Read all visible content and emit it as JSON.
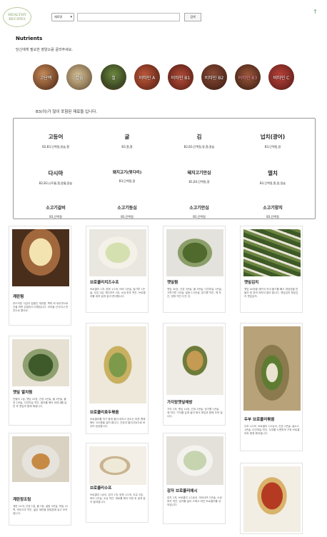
{
  "header": {
    "logo_text": "HEALTHY RECIPES",
    "select_value": "재료명",
    "search_placeholder": "",
    "search_button": "검색",
    "top_icon": "arrow-up-icon"
  },
  "page": {
    "title": "Nutrients",
    "subtitle": "당신에게 필요한 영양소를 골라주세요."
  },
  "nutrients": [
    {
      "label": "고단백"
    },
    {
      "label": "칼슘"
    },
    {
      "label": "철"
    },
    {
      "label": "비타민 A"
    },
    {
      "label": "비타민 B1"
    },
    {
      "label": "비타민 B2"
    },
    {
      "label": "비타민 B3"
    },
    {
      "label": "비타민 C"
    }
  ],
  "active_nutrient_index": 6,
  "hint": "B3(이)가 많이 포함된 재료들 입니다.",
  "foods": [
    {
      "name": "고등어",
      "sub": "B2,B3,단백질,칼슘,철"
    },
    {
      "name": "굴",
      "sub": "B3,철,철"
    },
    {
      "name": "김",
      "sub": "B2,B3,단백질,칼,철,칼슘"
    },
    {
      "name": "넙치(광어)",
      "sub": "B3,단백질,칼"
    },
    {
      "name": "다시마",
      "sub": "B2,B3,니트륨,철,칼륨,칼슘"
    },
    {
      "name": "돼지고기(뒷다리)",
      "sub": "B3,단백질,칼"
    },
    {
      "name": "돼지고기안심",
      "sub": "B1,B3,단백질,칼"
    },
    {
      "name": "멸치",
      "sub": "B3,단백질,철,칼,칼슘"
    },
    {
      "name": "소고기갈비",
      "sub": "B3,단백질"
    },
    {
      "name": "소고기등심",
      "sub": "B3,단백질"
    },
    {
      "name": "소고기안심",
      "sub": "B3,단백질"
    },
    {
      "name": "소고기양지",
      "sub": "B3,단백질"
    }
  ],
  "recipes": [
    {
      "title": "계란찜",
      "desc": "부드러운 식감이 일품인 계란찜. 쪽파 와 새우젓으로 간을 하면 감칠맛이 더해집니다. 아이들 간식이나 반찬으로 좋아요."
    },
    {
      "title": "브로콜리치즈수프",
      "desc": "브로콜리 1개, 양파 1/2개, 버터 1큰술, 밀가루 1큰술, 우유 2컵, 체다치즈 2장, 소금·후추 약간. 브로콜리를 데쳐 곱게 갈아 준비합니다."
    },
    {
      "title": "깻잎찜",
      "desc": "깻잎 30장, 간장 3큰술, 물 3큰술, 다진마늘 1큰술, 고춧가루 1큰술, 설탕 0.5큰술, 참기름 약간, 깨 약간, 양파 약간 다진 것."
    },
    {
      "title": "깻잎김치",
      "desc": "깻잎 40장을 깨끗이 씻어 물기를 빼고 양념장을 만들어 한 장씩 켜켜이 발라 줍니다. 깻잎김치 깻잎김치 깻잎김치."
    },
    {
      "title": "깻잎 멸치찜",
      "desc": "잔멸치 1컵, 깻잎 20장, 간장 2큰술, 물 3큰술, 물엿 1큰술, 다진마늘 약간. 멸치를 볶아 비린내를 날린 후 깻잎과 함께 쪄냅니다."
    },
    {
      "title": "브로콜리호두볶음",
      "desc": "브로콜리를 먹기 좋게 썰어 데치고 호두는 마른 팬에 볶아 고소함을 살려 줍니다. 간장과 올리고당으로 버무려 완성합니다."
    },
    {
      "title": "가지망깻잎채방",
      "desc": "가지 2개, 깻잎 10장, 간장 2큰술, 참기름 1큰술, 깨 약간. 가지를 길게 썰어 쪄서 깻잎과 함께 무쳐 냅니다."
    },
    {
      "title": "두부 브로콜리볶음",
      "desc": "두부 1/2모, 브로콜리 1/2송이, 간장 1큰술, 굴소스 1큰술, 다진마늘 약간. 두부를 노릇하게 구워 브로콜리와 함께 볶아냅니다."
    },
    {
      "title": "계란장조림",
      "desc": "계란 10개, 간장 1컵, 물 2컵, 설탕 3큰술, 마늘 10쪽, 꽈리고추 약간. 삶은 계란을 양념장에 넣고 조려냅니다."
    },
    {
      "title": "브로콜리수프",
      "desc": "브로콜리 1송이, 감자 1개, 양파 1/2개, 우유 2컵, 버터 1큰술, 소금 약간. 재료를 볶아 익힌 후 곱게 갈아 끓여냅니다."
    },
    {
      "title": "감자 브로콜리에시",
      "desc": "감자 2개, 브로콜리 1/2송이, 마요네즈 2큰술, 소금·후추 약간. 감자를 삶아 으깨고 데친 브로콜리를 섞어냅니다."
    },
    {
      "title": "",
      "desc": ""
    }
  ],
  "colors": {
    "accent": "#5aa05a",
    "active_label": "#ff9aa8",
    "panel_border": "#999999"
  }
}
